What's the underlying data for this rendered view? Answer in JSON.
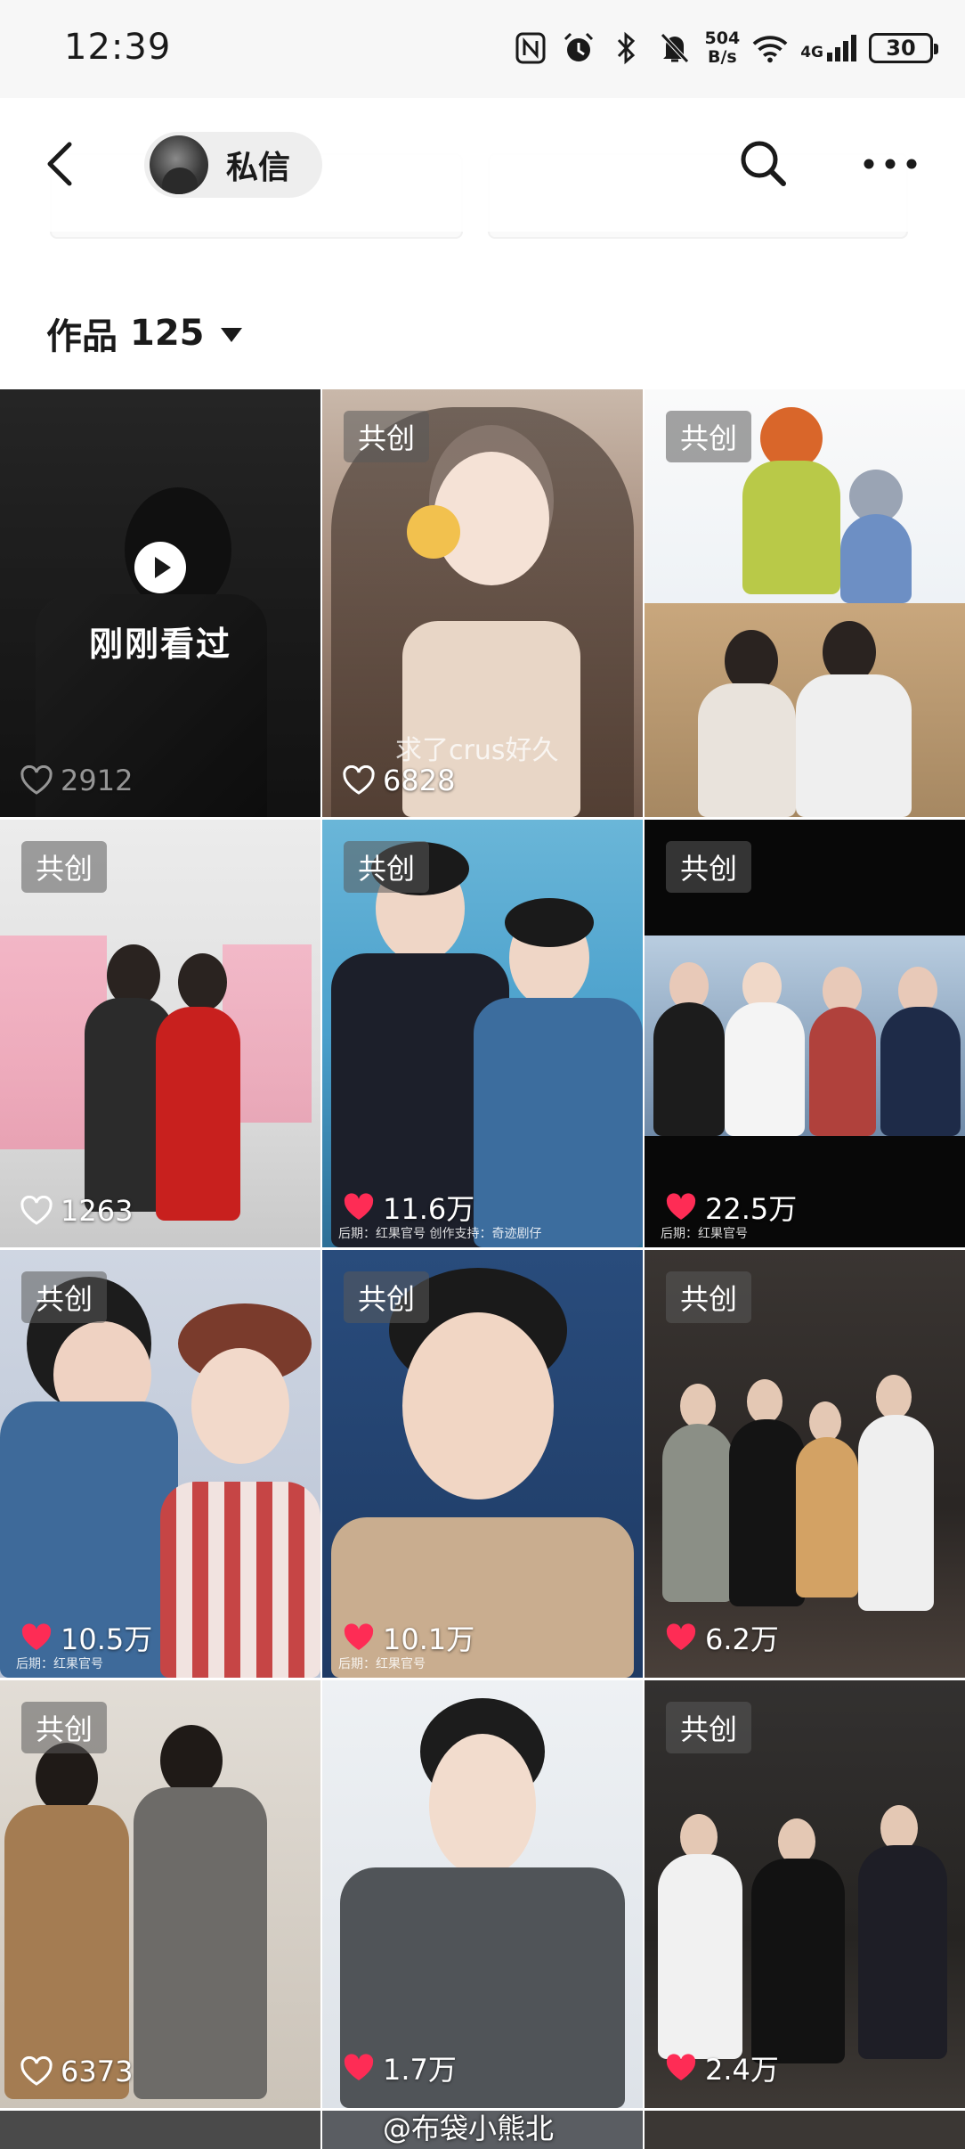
{
  "status_bar": {
    "time": "12:39",
    "net_speed_top": "504",
    "net_speed_bottom": "B/s",
    "network": "4G",
    "battery": "30"
  },
  "nav": {
    "pill_label": "私信"
  },
  "works": {
    "label": "作品",
    "count": "125"
  },
  "videos": [
    {
      "tag": "",
      "likes": "2912",
      "liked": false,
      "recently_viewed": true,
      "seen_label": "刚刚看过",
      "caption": "",
      "credit": ""
    },
    {
      "tag": "共创",
      "likes": "6828",
      "liked": false,
      "caption": "求了crus好久",
      "credit": ""
    },
    {
      "tag": "共创",
      "likes": "",
      "liked": false,
      "caption": "",
      "credit": ""
    },
    {
      "tag": "共创",
      "likes": "1263",
      "liked": false,
      "caption": "",
      "credit": ""
    },
    {
      "tag": "共创",
      "likes": "11.6万",
      "liked": true,
      "caption": "",
      "credit": "后期：红果官号 创作支持：奇迹剧仔"
    },
    {
      "tag": "共创",
      "likes": "22.5万",
      "liked": true,
      "caption": "",
      "credit": "后期：红果官号"
    },
    {
      "tag": "共创",
      "likes": "10.5万",
      "liked": true,
      "caption": "",
      "credit": "后期：红果官号"
    },
    {
      "tag": "共创",
      "likes": "10.1万",
      "liked": true,
      "caption": "",
      "credit": "后期：红果官号"
    },
    {
      "tag": "共创",
      "likes": "6.2万",
      "liked": true,
      "caption": "",
      "credit": ""
    },
    {
      "tag": "共创",
      "likes": "6373",
      "liked": false,
      "caption": "",
      "credit": ""
    },
    {
      "tag": "",
      "likes": "1.7万",
      "liked": true,
      "caption": "",
      "credit": ""
    },
    {
      "tag": "共创",
      "likes": "2.4万",
      "liked": true,
      "caption": "",
      "credit": ""
    }
  ],
  "watermark": "@布袋小熊北",
  "colors": {
    "like_red": "#fe2c55",
    "accent_text": "#1a1a1a"
  }
}
